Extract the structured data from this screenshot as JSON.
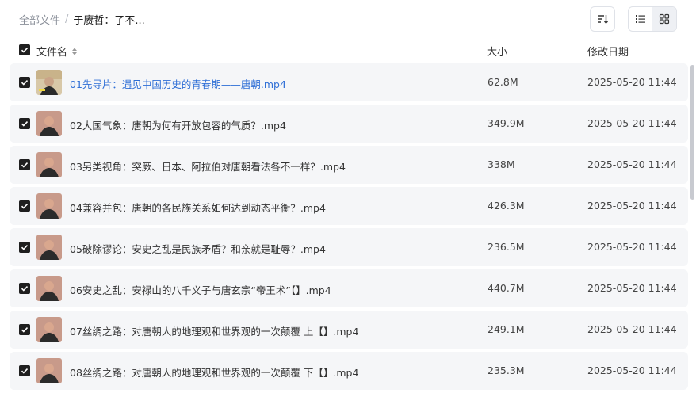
{
  "breadcrumb": {
    "root": "全部文件",
    "separator": "/",
    "current": "于赓哲：了不..."
  },
  "columns": {
    "name": "文件名",
    "size": "大小",
    "date": "修改日期"
  },
  "files": [
    {
      "name": "01先导片：遇见中国历史的青春期——唐朝.mp4",
      "size": "62.8M",
      "date": "2025-05-20 11:44"
    },
    {
      "name": "02大国气象：唐朝为何有开放包容的气质？.mp4",
      "size": "349.9M",
      "date": "2025-05-20 11:44"
    },
    {
      "name": "03另类视角：突厥、日本、阿拉伯对唐朝看法各不一样？.mp4",
      "size": "338M",
      "date": "2025-05-20 11:44"
    },
    {
      "name": "04兼容并包：唐朝的各民族关系如何达到动态平衡？.mp4",
      "size": "426.3M",
      "date": "2025-05-20 11:44"
    },
    {
      "name": "05破除谬论：安史之乱是民族矛盾？和亲就是耻辱？.mp4",
      "size": "236.5M",
      "date": "2025-05-20 11:44"
    },
    {
      "name": "06安史之乱：安禄山的八千义子与唐玄宗“帝王术”【】.mp4",
      "size": "440.7M",
      "date": "2025-05-20 11:44"
    },
    {
      "name": "07丝绸之路：对唐朝人的地理观和世界观的一次颠覆 上【】.mp4",
      "size": "249.1M",
      "date": "2025-05-20 11:44"
    },
    {
      "name": "08丝绸之路：对唐朝人的地理观和世界观的一次颠覆 下【】.mp4",
      "size": "235.3M",
      "date": "2025-05-20 11:44"
    }
  ],
  "icons": {
    "sort": "sort-icon",
    "list_view": "list-view-icon",
    "grid_view": "grid-view-icon",
    "checkbox": "checkbox-checked-icon",
    "thumbnail": "video-thumbnail"
  },
  "colors": {
    "link": "#2f6fd6",
    "row_bg": "#f5f6f8",
    "checkbox": "#1f1f1f"
  }
}
